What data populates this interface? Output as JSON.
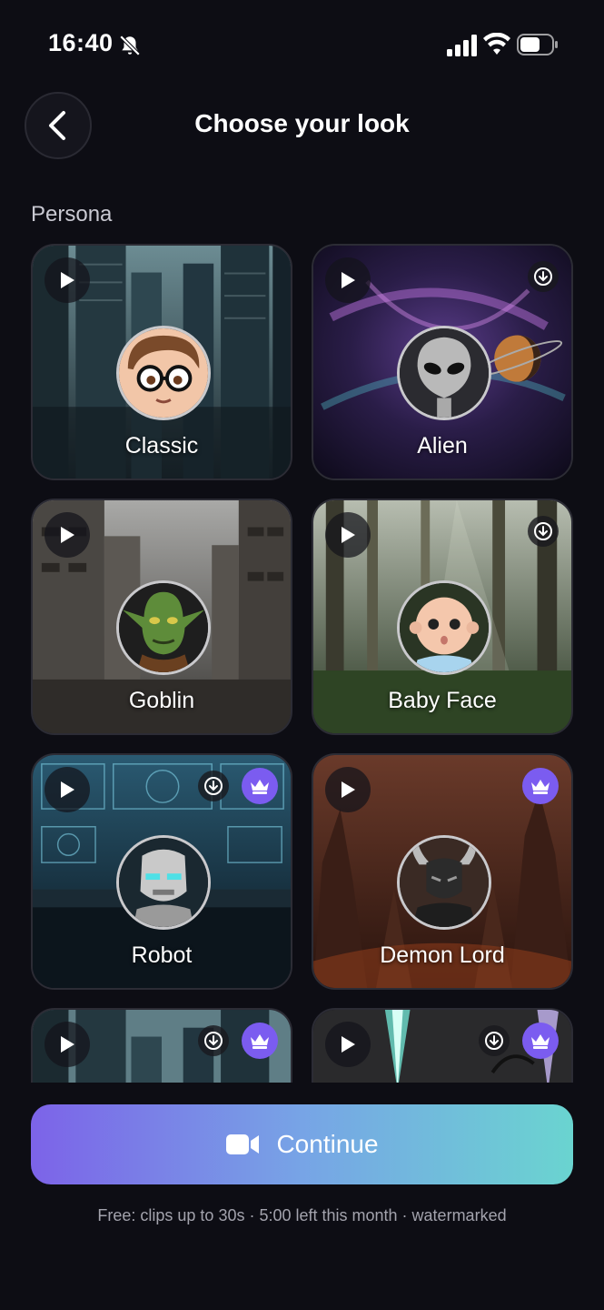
{
  "status_bar": {
    "time": "16:40",
    "icons": [
      "bell-slash-icon",
      "cellular-signal-icon",
      "wifi-icon",
      "battery-icon"
    ]
  },
  "header": {
    "title": "Choose your look",
    "back_icon": "chevron-left-icon"
  },
  "section": {
    "label": "Persona"
  },
  "personas": [
    {
      "name": "Classic",
      "downloadable": false,
      "premium": false,
      "scene": "city"
    },
    {
      "name": "Alien",
      "downloadable": true,
      "premium": false,
      "scene": "galaxy"
    },
    {
      "name": "Goblin",
      "downloadable": false,
      "premium": false,
      "scene": "ruins"
    },
    {
      "name": "Baby Face",
      "downloadable": true,
      "premium": false,
      "scene": "forest"
    },
    {
      "name": "Robot",
      "downloadable": true,
      "premium": true,
      "scene": "control-room"
    },
    {
      "name": "Demon Lord",
      "downloadable": false,
      "premium": true,
      "scene": "hellscape"
    },
    {
      "name": "",
      "downloadable": true,
      "premium": true,
      "scene": "city"
    },
    {
      "name": "",
      "downloadable": true,
      "premium": true,
      "scene": "neon-portal"
    }
  ],
  "continue_button": {
    "label": "Continue",
    "icon": "video-camera-icon"
  },
  "footer": {
    "note": "Free: clips up to 30s · 5:00 left this month · watermarked"
  },
  "colors": {
    "background": "#0d0d14",
    "premium_badge": "#7b5cf0",
    "gradient_start": "#7c63e8",
    "gradient_end": "#6ad4d0"
  }
}
